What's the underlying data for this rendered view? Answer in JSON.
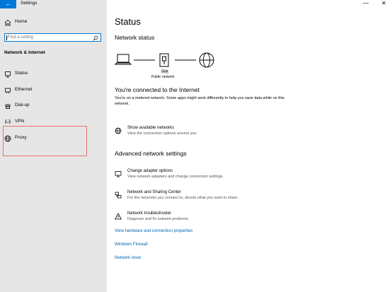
{
  "app": {
    "title": "Settings",
    "back_glyph": "←"
  },
  "window": {
    "minimize": "—",
    "close": "✕"
  },
  "sidebar": {
    "home_label": "Home",
    "search_placeholder": "Find a setting",
    "section_title": "Network & Internet",
    "items": [
      {
        "label": "Status",
        "icon": "status-icon"
      },
      {
        "label": "Ethernet",
        "icon": "ethernet-icon"
      },
      {
        "label": "Dial-up",
        "icon": "dialup-icon"
      },
      {
        "label": "VPN",
        "icon": "vpn-icon"
      },
      {
        "label": "Proxy",
        "icon": "globe-icon"
      }
    ]
  },
  "main": {
    "title": "Status",
    "network_status_heading": "Network status",
    "diagram_network_char": "网络",
    "diagram_label": "Public network",
    "connected_heading": "You're connected to the Internet",
    "connected_desc": "You're on a metered network. Some apps might work differently to help you save data while on this network.",
    "show_networks": {
      "title": "Show available networks",
      "subtitle": "View the connection options around you."
    },
    "advanced_heading": "Advanced network settings",
    "adapter": {
      "title": "Change adapter options",
      "subtitle": "View network adapters and change connection settings."
    },
    "sharing": {
      "title": "Network and Sharing Center",
      "subtitle": "For the networks you connect to, decide what you want to share."
    },
    "troubleshooter": {
      "title": "Network troubleshooter",
      "subtitle": "Diagnose and fix network problems."
    },
    "links": {
      "hardware": "View hardware and connection properties",
      "firewall": "Windows Firewall",
      "reset": "Network reset"
    }
  },
  "colors": {
    "accent": "#0078d7",
    "link": "#0066b4",
    "highlight_border": "#e8726b",
    "sidebar_bg": "#e6e6e6"
  }
}
